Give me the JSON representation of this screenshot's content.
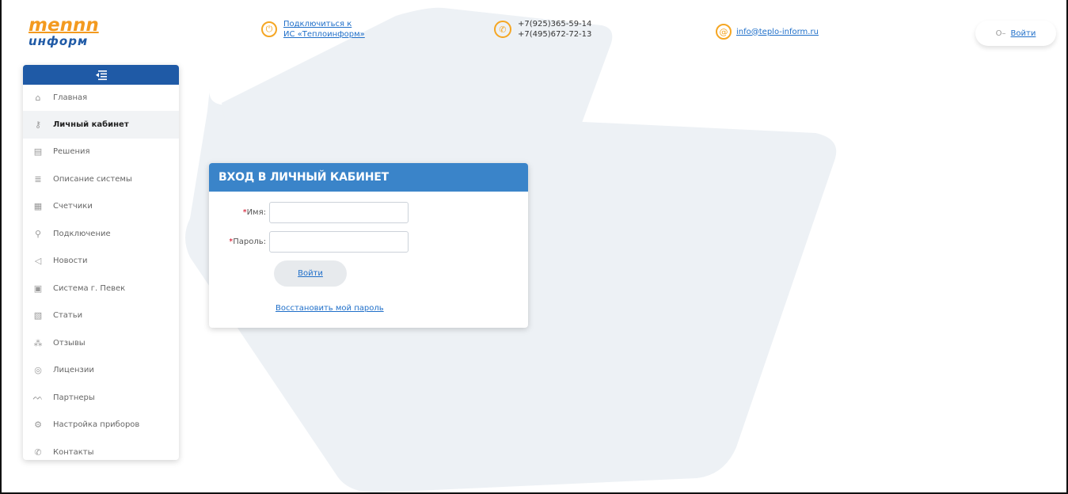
{
  "brand": {
    "logo_top": "mennn",
    "logo_bottom": "uнфoрм"
  },
  "header": {
    "connect_line1": "Подключиться к",
    "connect_line2": "ИС «Теплоинформ»",
    "phone1": "+7(925)365-59-14",
    "phone2": "+7(495)672-72-13",
    "email": "info@teplo-inform.ru",
    "login_label": "Войти"
  },
  "sidebar": {
    "items": [
      {
        "label": "Главная",
        "icon": "home-icon",
        "glyph": "⌂"
      },
      {
        "label": "Личный кабинет",
        "icon": "user-key-icon",
        "glyph": "⚷"
      },
      {
        "label": "Решения",
        "icon": "calculator-icon",
        "glyph": "▤"
      },
      {
        "label": "Описание системы",
        "icon": "document-icon",
        "glyph": "≣"
      },
      {
        "label": "Счетчики",
        "icon": "meter-icon",
        "glyph": "▦"
      },
      {
        "label": "Подключение",
        "icon": "plug-icon",
        "glyph": "⚲"
      },
      {
        "label": "Новости",
        "icon": "megaphone-icon",
        "glyph": "◁"
      },
      {
        "label": "Система г. Певек",
        "icon": "system-icon",
        "glyph": "▣"
      },
      {
        "label": "Статьи",
        "icon": "articles-icon",
        "glyph": "▧"
      },
      {
        "label": "Отзывы",
        "icon": "reviews-icon",
        "glyph": "⁂"
      },
      {
        "label": "Лицензии",
        "icon": "license-icon",
        "glyph": "◎"
      },
      {
        "label": "Партнеры",
        "icon": "partners-icon",
        "glyph": "ᨓ"
      },
      {
        "label": "Настройка приборов",
        "icon": "settings-icon",
        "glyph": "⚙"
      },
      {
        "label": "Контакты",
        "icon": "phone-icon",
        "glyph": "✆"
      }
    ]
  },
  "login_form": {
    "title": "ВХОД В ЛИЧНЫЙ КАБИНЕТ",
    "name_label": "Имя:",
    "password_label": "Пароль:",
    "required_mark": "*",
    "submit_label": "Войти",
    "recover_link": "Восстановить мой пароль"
  },
  "colors": {
    "primary": "#1f5aa6",
    "card_header": "#3a84c9",
    "accent": "#f39a1f",
    "link": "#1f6fc9",
    "required": "#d0021b"
  }
}
